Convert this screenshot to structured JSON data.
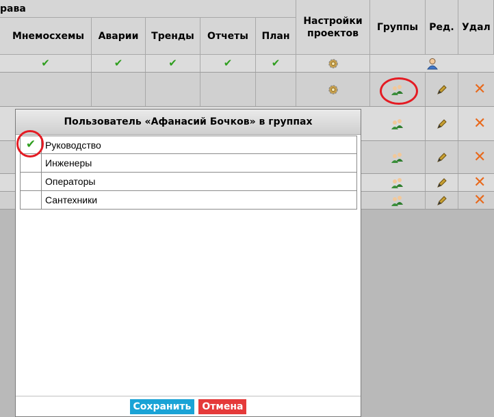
{
  "table": {
    "group_header": "рава",
    "columns": {
      "schemes": "Мнемосхемы",
      "alarms": "Аварии",
      "trends": "Тренды",
      "reports": "Отчеты",
      "plan": "План",
      "settings_line1": "Настройки",
      "settings_line2": "проектов",
      "groups": "Группы",
      "edit": "Ред.",
      "delete": "Удал"
    }
  },
  "dialog": {
    "title": "Пользователь «Афанасий Бочков» в группах",
    "groups": [
      {
        "label": "Руководство",
        "checked": true
      },
      {
        "label": "Инженеры",
        "checked": false
      },
      {
        "label": "Операторы",
        "checked": false
      },
      {
        "label": "Сантехники",
        "checked": false
      }
    ],
    "save_label": "Сохранить",
    "cancel_label": "Отмена"
  },
  "colors": {
    "check": "#2e9e1e",
    "delete": "#e8691c",
    "highlight": "#e41b23",
    "save": "#1aa3d6",
    "cancel": "#e53a3a"
  }
}
